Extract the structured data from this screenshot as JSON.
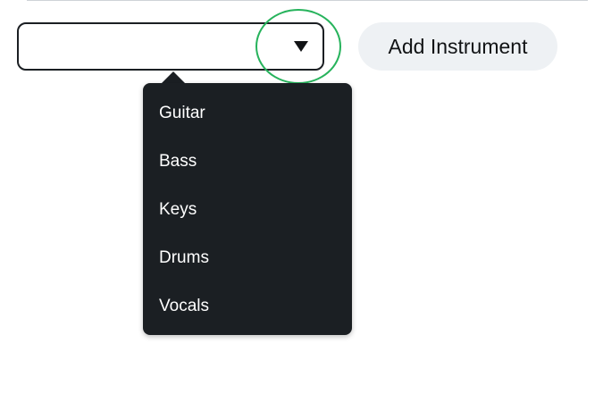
{
  "instrument_select": {
    "selected_value": "",
    "arrow_icon": "triangle-down-icon"
  },
  "add_button": {
    "label": "Add Instrument"
  },
  "dropdown": {
    "options": [
      "Guitar",
      "Bass",
      "Keys",
      "Drums",
      "Vocals"
    ]
  },
  "colors": {
    "highlight_ring": "#27b35c",
    "menu_background": "#1b1f23",
    "button_background": "#eef1f4"
  }
}
